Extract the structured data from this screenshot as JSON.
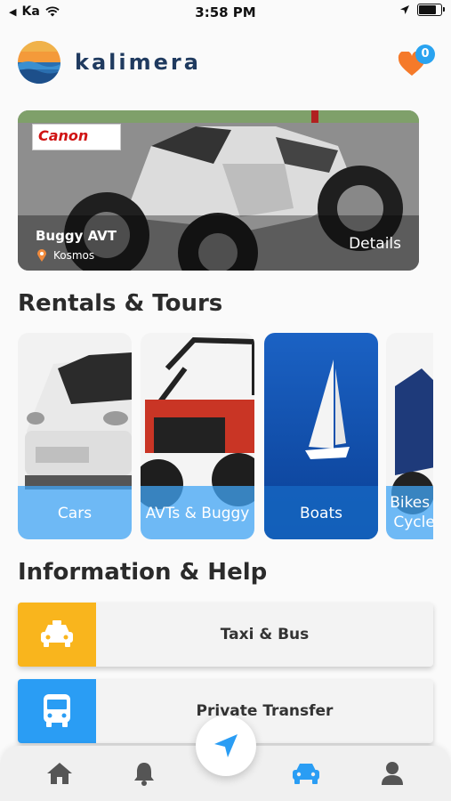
{
  "status_bar": {
    "carrier": "Ka",
    "time": "3:58 PM"
  },
  "header": {
    "brand": "kalimera",
    "favorites_count": "0"
  },
  "featured": {
    "title": "Buggy AVT",
    "location": "Kosmos",
    "details_label": "Details",
    "sign_text": "Canon"
  },
  "sections": {
    "rentals_title": "Rentals & Tours",
    "info_title": "Information & Help"
  },
  "categories": [
    {
      "label": "Cars"
    },
    {
      "label": "AVTs & Buggy"
    },
    {
      "label": "Boats"
    },
    {
      "label": "Bikes & Cycles"
    }
  ],
  "info_items": [
    {
      "label": "Taxi & Bus",
      "icon": "taxi-icon",
      "color": "#f9b51d"
    },
    {
      "label": "Private Transfer",
      "icon": "bus-icon",
      "color": "#2a9df4"
    }
  ],
  "tabs": [
    {
      "icon": "home-icon"
    },
    {
      "icon": "bell-icon"
    },
    {
      "icon": "navigation-icon"
    },
    {
      "icon": "car-icon",
      "active": true
    },
    {
      "icon": "user-icon"
    }
  ],
  "colors": {
    "accent": "#2a9df4",
    "heart": "#f57a2a",
    "brand": "#1f3a5f"
  }
}
